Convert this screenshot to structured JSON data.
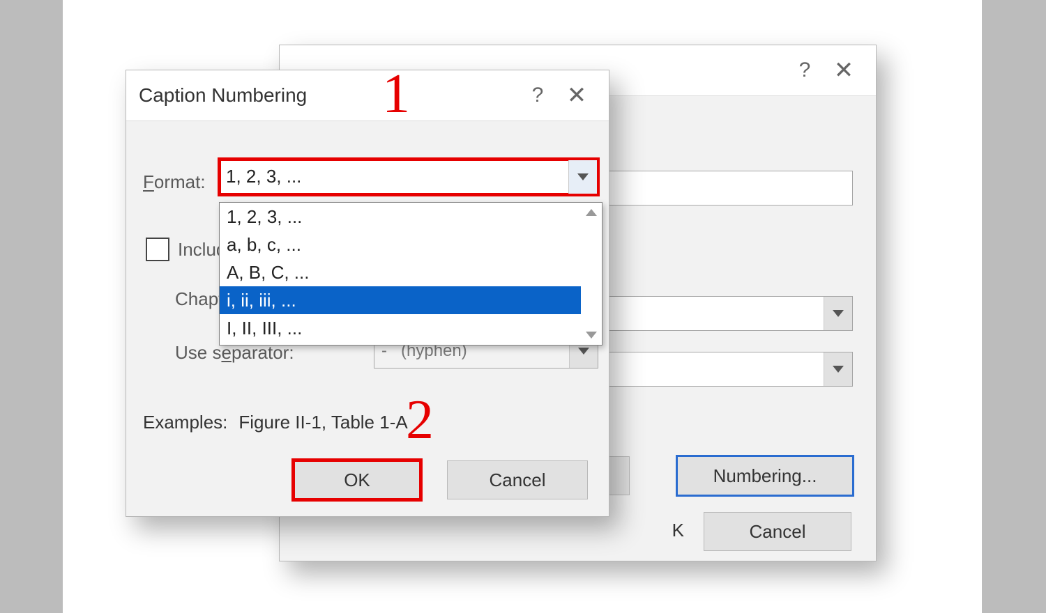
{
  "back_dialog": {
    "numbering_btn": "Numbering...",
    "cancel_btn": "Cancel",
    "ok_suffix": "K"
  },
  "front_dialog": {
    "title": "Caption Numbering",
    "format_label": "Format:",
    "format_value": "1, 2, 3, ...",
    "include_label_fragment": "Include",
    "chapter_label_fragment": "Chapt",
    "separator_label": "Use separator:",
    "separator_value": "(hyphen)",
    "examples_label": "Examples:",
    "examples_value": "Figure II-1, Table 1-A",
    "ok_btn": "OK",
    "cancel_btn": "Cancel"
  },
  "format_dropdown": {
    "options": [
      "1, 2, 3, ...",
      "a, b, c, ...",
      "A, B, C, ...",
      "i, ii, iii, ...",
      "I, II, III, ..."
    ],
    "selected_index": 3
  },
  "callouts": {
    "one": "1",
    "two": "2"
  }
}
